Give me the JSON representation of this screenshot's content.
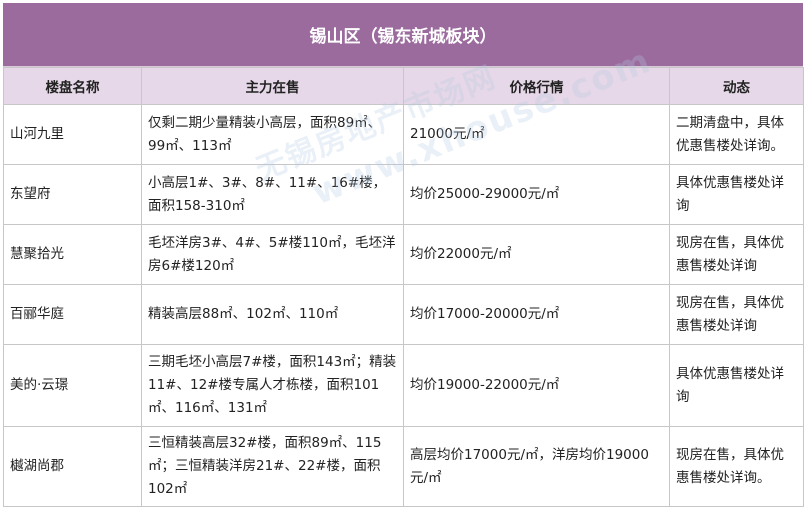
{
  "title": "锡山区（锡东新城板块）",
  "columns": [
    "楼盘名称",
    "主力在售",
    "价格行情",
    "动态"
  ],
  "rows": [
    {
      "name": "山河九里",
      "main": "仅剩二期少量精装小高层，面积89㎡、99㎡、113㎡",
      "price": "21000元/㎡",
      "status": "二期清盘中，具体优惠售楼处详询。"
    },
    {
      "name": "东望府",
      "main": "小高层1#、3#、8#、11#、16#楼，面积158-310㎡",
      "price": "均价25000-29000元/㎡",
      "status": "具体优惠售楼处详询"
    },
    {
      "name": "慧聚拾光",
      "main": "毛坯洋房3#、4#、5#楼110㎡，毛坯洋房6#楼120㎡",
      "price": "均价22000元/㎡",
      "status": "现房在售，具体优惠售楼处详询"
    },
    {
      "name": "百郦华庭",
      "main": "精装高层88㎡、102㎡、110㎡",
      "price": "均价17000-20000元/㎡",
      "status": "现房在售，具体优惠售楼处详询"
    },
    {
      "name": "美的·云璟",
      "main": "三期毛坯小高层7#楼，面积143㎡；精装11#、12#楼专属人才栋楼，面积101㎡、116㎡、131㎡",
      "price": "均价19000-22000元/㎡",
      "status": "具体优惠售楼处详询"
    },
    {
      "name": "樾湖尚郡",
      "main": "三恒精装高层32#楼，面积89㎡、115㎡；三恒精装洋房21#、22#楼，面积102㎡",
      "price": "高层均价17000元/㎡，洋房均价19000元/㎡",
      "status": "现房在售，具体优惠售楼处详询。"
    }
  ],
  "watermark": {
    "text": "无锡房地产市场网",
    "url": "www.xhouse.com"
  },
  "colors": {
    "title_bg": "#9b6b9e",
    "header_bg": "#e6d8e8",
    "border": "#c7c7c7"
  }
}
